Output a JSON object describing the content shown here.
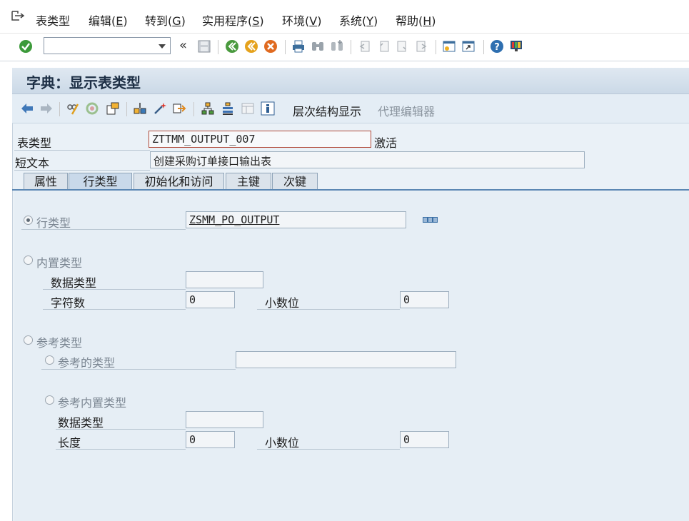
{
  "menu": {
    "items": [
      {
        "text": "表类型",
        "key": ""
      },
      {
        "text": "编辑(",
        "key": "E",
        "tail": ")"
      },
      {
        "text": "转到(",
        "key": "G",
        "tail": ")"
      },
      {
        "text": "实用程序(",
        "key": "S",
        "tail": ")"
      },
      {
        "text": "环境(",
        "key": "V",
        "tail": ")"
      },
      {
        "text": "系统(",
        "key": "Y",
        "tail": ")"
      },
      {
        "text": "帮助(",
        "key": "H",
        "tail": ")"
      }
    ]
  },
  "toolbar": {
    "command_value": "",
    "expand_glyph": "«",
    "icons": [
      "enter-icon",
      "save-icon",
      "back-icon",
      "exit-icon",
      "cancel-icon",
      "print-icon",
      "find-icon",
      "find-next-icon",
      "first-page-icon",
      "prev-page-icon",
      "next-page-icon",
      "last-page-icon",
      "new-session-icon",
      "shortcut-icon",
      "help-icon",
      "customize-layout-icon"
    ]
  },
  "page": {
    "title": "字典：显示表类型"
  },
  "app_toolbar": {
    "hierarchy_label": "层次结构显示",
    "proxy_editor_label": "代理编辑器",
    "icons": [
      "nav-back-icon",
      "nav-forward-icon",
      "display-change-icon",
      "activate-icon",
      "other-object-icon",
      "where-used-icon",
      "magic-wand-icon",
      "navigate-icon",
      "hierarchy-icon",
      "align-icon",
      "layout-icon",
      "info-icon"
    ]
  },
  "header": {
    "table_type_label": "表类型",
    "table_type_value": "ZTTMM_OUTPUT_007",
    "status": "激活",
    "short_text_label": "短文本",
    "short_text_value": "创建采购订单接口输出表"
  },
  "tabs": [
    {
      "label": "属性",
      "active": false
    },
    {
      "label": "行类型",
      "active": true
    },
    {
      "label": "初始化和访问",
      "active": false
    },
    {
      "label": "主键",
      "active": false
    },
    {
      "label": "次键",
      "active": false
    }
  ],
  "row_type": {
    "radio_label": "行类型",
    "value": "ZSMM_PO_OUTPUT",
    "builtin_label": "内置类型",
    "data_type_label": "数据类型",
    "data_type_value": "",
    "chars_label": "字符数",
    "chars_value": "0",
    "decimals_label": "小数位",
    "decimals_value": "0",
    "ref_type_label": "参考类型",
    "ref_of_type_label": "参考的类型",
    "ref_of_type_value": "",
    "ref_builtin_label": "参考内置类型",
    "ref_data_type_label": "数据类型",
    "ref_data_type_value": "",
    "length_label": "长度",
    "length_value": "0",
    "ref_decimals_label": "小数位",
    "ref_decimals_value": "0"
  }
}
